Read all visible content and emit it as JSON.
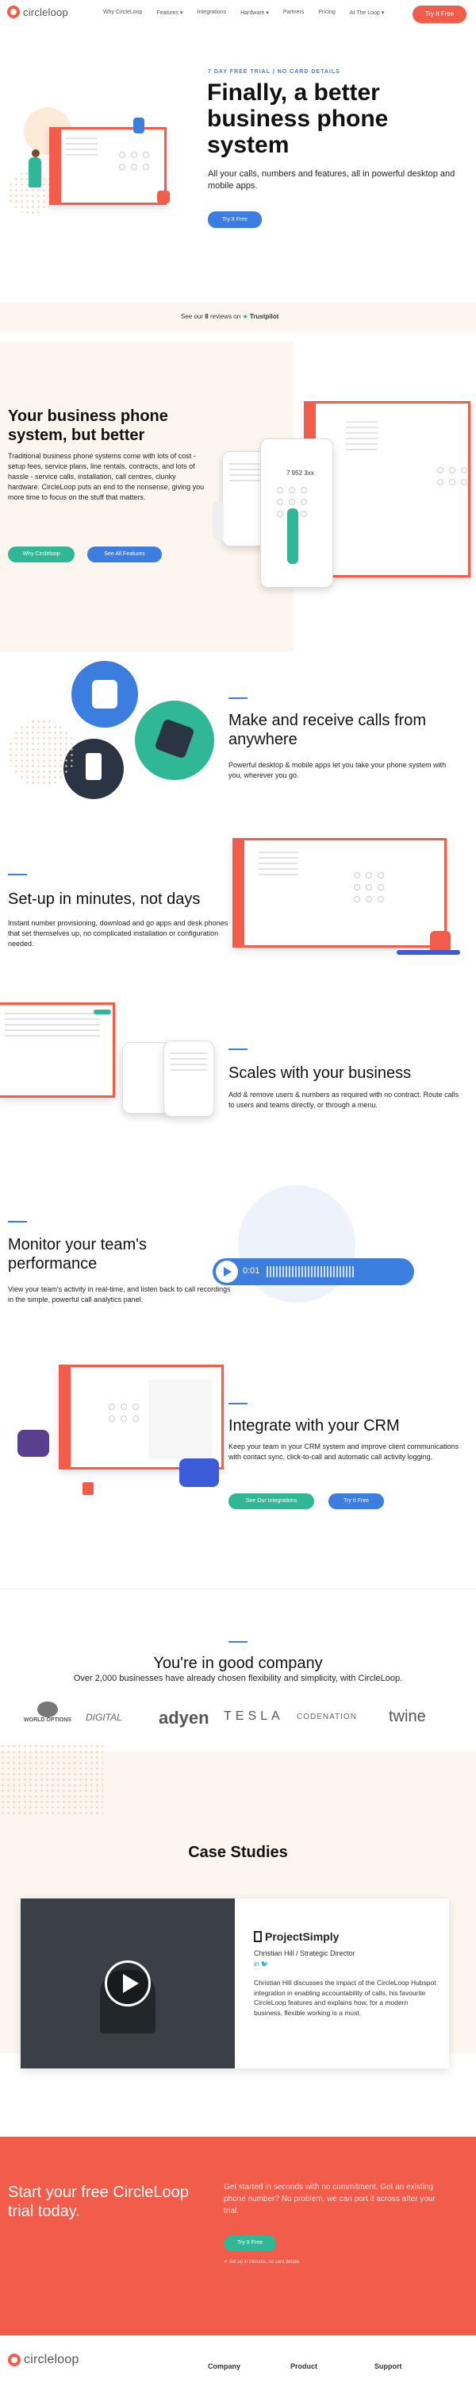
{
  "header": {
    "logo_text": "circleloop",
    "nav": [
      {
        "label": "Why CircleLoop"
      },
      {
        "label": "Features ▾"
      },
      {
        "label": "Integrations"
      },
      {
        "label": "Hardware ▾"
      },
      {
        "label": "Partners"
      },
      {
        "label": "Pricing"
      },
      {
        "label": "At The Loop ▾"
      }
    ],
    "cta_label": "Try It Free"
  },
  "hero": {
    "eyebrow": "7 DAY FREE TRIAL | NO CARD DETAILS",
    "title": "Finally, a better business phone system",
    "subtitle": "All your calls, numbers and features, all in powerful desktop and mobile apps.",
    "cta_label": "Try It Free"
  },
  "trustpilot": {
    "prefix": "See our",
    "count": "8",
    "suffix": "reviews on",
    "brand": "Trustpilot"
  },
  "better": {
    "title": "Your business phone system, but better",
    "body": "Traditional business phone systems come with lots of cost - setup fees, service plans, line rentals, contracts, and lots of hassle - service calls, installation, call centres, clunky hardware. CircleLoop puts an end to the nonsense, giving you more time to focus on the stuff that matters.",
    "btn_why": "Why Circleloop",
    "btn_features": "See All Features",
    "phone_number": "7 952 3xx"
  },
  "calls": {
    "title": "Make and receive calls from anywhere",
    "body": "Powerful desktop & mobile apps let you take your phone system with you, wherever you go."
  },
  "setup": {
    "title": "Set-up in minutes, not days",
    "body": "Instant number provisioning, download and go apps and desk phones that set themselves up, no complicated installation or configuration needed."
  },
  "scales": {
    "title": "Scales with your business",
    "body": "Add & remove users & numbers as required with no contract. Route calls to users and teams directly, or through a menu."
  },
  "monitor": {
    "title": "Monitor your team's performance",
    "body": "View your team's activity in real-time, and listen back to call recordings in the simple, powerful call analytics panel.",
    "player_time": "0:01"
  },
  "crm": {
    "title": "Integrate with your CRM",
    "body": "Keep your team in your CRM system and improve client communications with contact sync, click-to-call and automatic call activity logging.",
    "btn_integrations": "See Our Integrations",
    "btn_try": "Try It Free"
  },
  "company": {
    "title": "You're in good company",
    "subtitle": "Over 2,000 businesses have already chosen flexibility and simplicity, with CircleLoop.",
    "logos": [
      "WORLD OPTIONS",
      "DIGITAL",
      "adyen",
      "TESLA",
      "CODENATION",
      "twine"
    ]
  },
  "case": {
    "title": "Case Studies",
    "brand": "ProjectSimply",
    "person": "Christian Hill / Strategic Director",
    "body": "Christian Hill discusses the impact of the CircleLoop Hubspot integration in enabling accountability of calls, his favourite CircleLoop features and explains how, for a modern business, flexible working is a must."
  },
  "trial": {
    "title": "Start your free CircleLoop trial today.",
    "body": "Get started in seconds with no commitment. Got an existing phone number? No problem, we can port it across after your trial.",
    "cta_label": "Try It Free",
    "note": "Set up in minutes, no card details"
  },
  "footer": {
    "logo_text": "circleloop",
    "cols": [
      "Company",
      "Product",
      "Support"
    ]
  },
  "colors": {
    "coral": "#f25c4a",
    "blue": "#3b7ee0",
    "green": "#2fb796",
    "cream": "#fdf6f0"
  }
}
